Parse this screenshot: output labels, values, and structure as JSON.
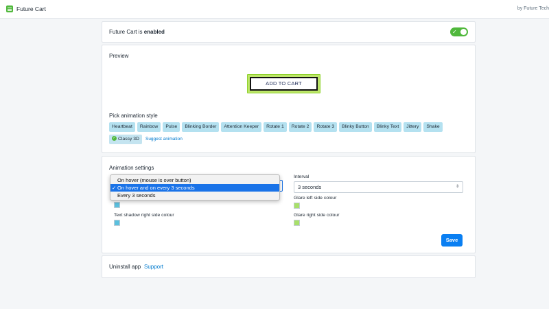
{
  "app": {
    "title": "Future Cart",
    "by_line": "by Future Tech",
    "icon": "app-list-icon"
  },
  "status": {
    "prefix": "Future Cart is ",
    "state": "enabled",
    "toggle_on": true,
    "toggle_icon": "checkmark-icon"
  },
  "preview": {
    "title": "Preview",
    "button_label": "ADD TO CART",
    "glare_color": "#bde66a"
  },
  "animation_style": {
    "label": "Pick animation style",
    "options": [
      "Heartbeat",
      "Rainbow",
      "Pulse",
      "Blinking Border",
      "Attention Keeper",
      "Rotate 1",
      "Rotate 2",
      "Rotate 3",
      "Blinky Button",
      "Blinky Text",
      "Jittery",
      "Shake",
      "Classy 3D"
    ],
    "selected": "Classy 3D",
    "suggest_link": "Suggest animation"
  },
  "settings": {
    "title": "Animation settings",
    "trigger_dropdown": {
      "options": [
        "On hover (mouse is over button)",
        "On hover and on every 3 seconds",
        "Every 3 seconds"
      ],
      "selected": "On hover and on every 3 seconds",
      "check_mark": "✓"
    },
    "interval": {
      "label": "Interval",
      "value": "3 seconds",
      "arrows": "⇕"
    },
    "text_shadow_left": {
      "color": "#5bc0de"
    },
    "text_shadow_right": {
      "label": "Text shadow right side colour",
      "color": "#5bc0de"
    },
    "glare_left": {
      "label": "Glare left side colour",
      "color": "#a8e06a"
    },
    "glare_right": {
      "label": "Glare right side colour",
      "color": "#a8e06a"
    },
    "save_label": "Save"
  },
  "footer": {
    "uninstall_label": "Uninstall app",
    "support_label": "Support"
  },
  "colors": {
    "accent": "#0a7ff2",
    "toggle_on": "#50b83c",
    "chip_bg": "#b4e1f0",
    "link": "#007ace"
  }
}
